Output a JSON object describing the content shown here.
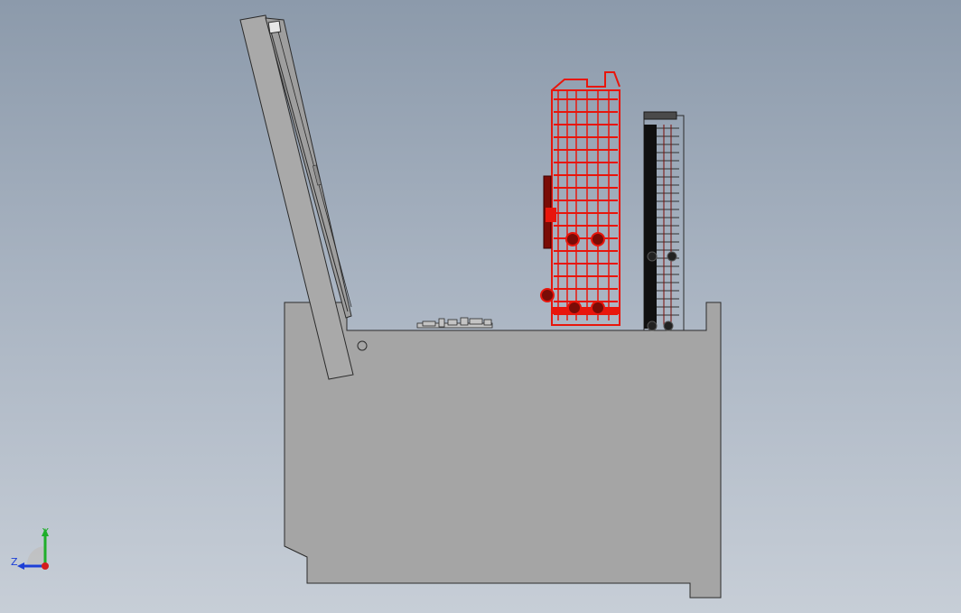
{
  "viewport": {
    "background_top": "#8c9aab",
    "background_bottom": "#c7ced7"
  },
  "model": {
    "body_color": "#a5a5a5",
    "edge_color": "#2b2b2b",
    "lid_color": "#a9a9a9",
    "rack_color": "#e8160c",
    "rack_dark": "#7a0c06",
    "black_rack_color": "#101010",
    "component_color": "#c4c4c4"
  },
  "triad": {
    "y_label": "Y",
    "z_label": "Z",
    "y_color": "#1fae2a",
    "z_color": "#1d3fd6",
    "x_color": "#d41c1c"
  }
}
